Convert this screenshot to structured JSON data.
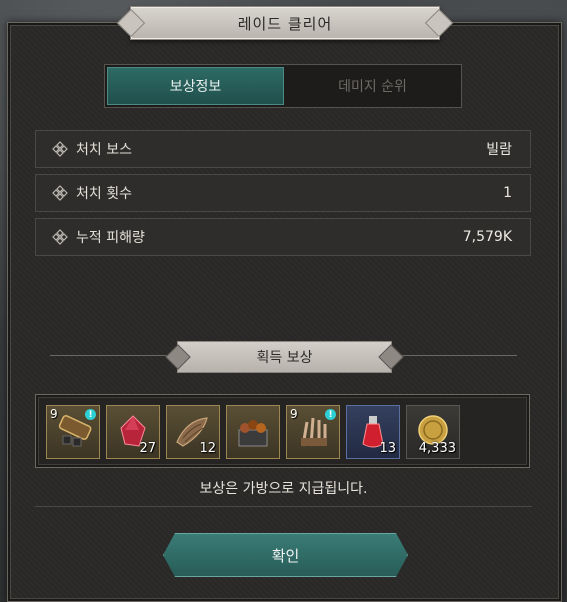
{
  "dialog": {
    "title": "레이드 클리어"
  },
  "tabs": [
    {
      "label": "보상정보",
      "active": true
    },
    {
      "label": "데미지 순위",
      "active": false
    }
  ],
  "info": [
    {
      "label": "처치 보스",
      "value": "빌람"
    },
    {
      "label": "처치 횟수",
      "value": "1"
    },
    {
      "label": "누적 피해량",
      "value": "7,579K"
    }
  ],
  "rewards_section": {
    "title": "획득 보상"
  },
  "rewards": [
    {
      "icon": "shovel-icon",
      "enhance": "9",
      "count": "",
      "alert": "!",
      "rarity": "gold"
    },
    {
      "icon": "crystal-icon",
      "enhance": "",
      "count": "27",
      "alert": "",
      "rarity": "gold"
    },
    {
      "icon": "scale-hide-icon",
      "enhance": "",
      "count": "12",
      "alert": "",
      "rarity": "gold"
    },
    {
      "icon": "ore-crate-icon",
      "enhance": "",
      "count": "",
      "alert": "",
      "rarity": "gold"
    },
    {
      "icon": "claw-gauntlet-icon",
      "enhance": "9",
      "count": "",
      "alert": "!",
      "rarity": "gold"
    },
    {
      "icon": "red-potion-icon",
      "enhance": "",
      "count": "13",
      "alert": "",
      "rarity": "blue"
    },
    {
      "icon": "gold-coin-icon",
      "enhance": "",
      "count": "4,333",
      "alert": "",
      "rarity": "normal"
    }
  ],
  "notice": "보상은 가방으로 지급됩니다.",
  "confirm_label": "확인",
  "colors": {
    "accent_teal": "#2f6b66",
    "plate": "#c9c4bd",
    "panel": "#2a2928"
  }
}
